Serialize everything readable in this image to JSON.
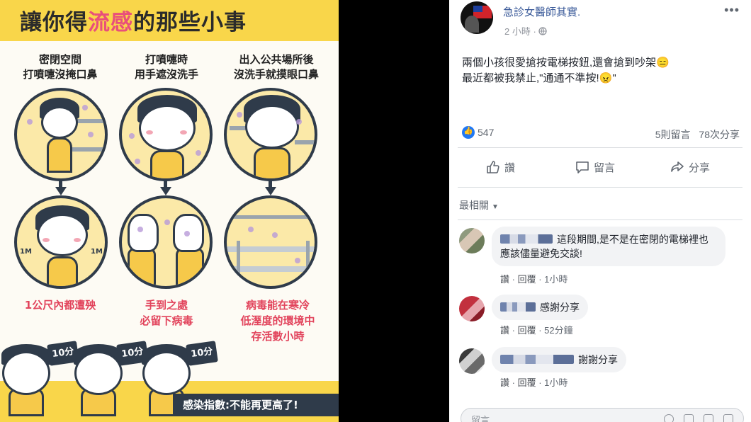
{
  "poster": {
    "title_pre": "讓你得",
    "title_hl": "流感",
    "title_post": "的那些小事",
    "columns": [
      {
        "head1": "密閉空間",
        "head2": "打噴嚏沒掩口鼻",
        "result1": "1公尺內都遭殃",
        "result2": ""
      },
      {
        "head1": "打噴嚏時",
        "head2": "用手遮沒洗手",
        "result1": "手到之處",
        "result2": "必留下病毒"
      },
      {
        "head1": "出入公共場所後",
        "head2": "沒洗手就摸眼口鼻",
        "result1": "病毒能在寒冷",
        "result2": "低溼度的環境中",
        "result3": "存活數小時"
      }
    ],
    "distance_label": "1M",
    "score_label": "10分",
    "infection_index": "感染指數:不能再更高了!"
  },
  "post": {
    "author": "急診女醫師其實.",
    "time": "2 小時",
    "globe_icon": "globe-icon",
    "line1": "兩個小孩很愛搶按電梯按鈕,還會搶到吵架😑",
    "line2": "最近都被我禁止,\"通通不準按!😠\"",
    "like_count": "547",
    "comments_count": "5則留言",
    "shares_count": "78次分享",
    "like_label": "讚",
    "comment_label": "留言",
    "share_label": "分享",
    "sort_label": "最相關"
  },
  "comments": [
    {
      "text": "這段期間,是不是在密閉的電梯裡也應該儘量避免交談!",
      "like": "讚",
      "reply": "回覆",
      "time": "1小時"
    },
    {
      "text": "感謝分享",
      "like": "讚",
      "reply": "回覆",
      "time": "52分鐘"
    },
    {
      "text": "謝謝分享",
      "like": "讚",
      "reply": "回覆",
      "time": "1小時"
    }
  ],
  "reply_placeholder": "留言……",
  "colors": {
    "fb_blue": "#385898",
    "accent_yellow": "#f9d64a",
    "pink": "#e94f7b",
    "result_red": "#e2445c"
  }
}
